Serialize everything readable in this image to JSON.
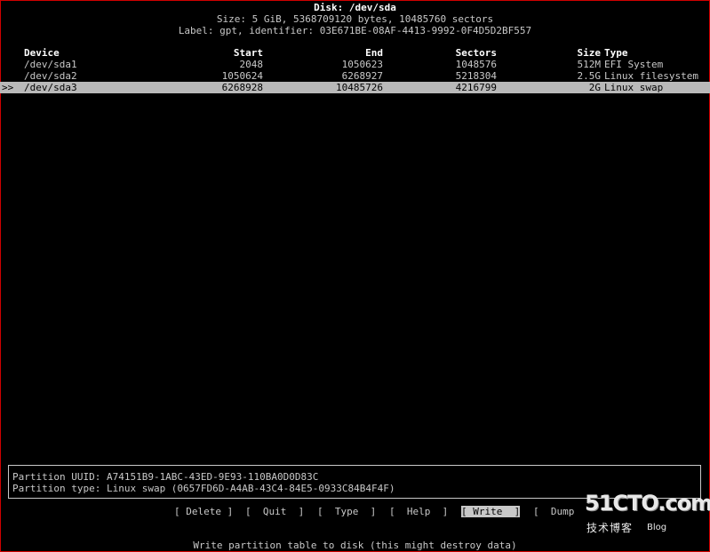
{
  "header": {
    "disk": "Disk: /dev/sda",
    "size": "Size: 5 GiB, 5368709120 bytes, 10485760 sectors",
    "label": "Label: gpt, identifier: 03E671BE-08AF-4413-9992-0F4D5D2BF557"
  },
  "table": {
    "columns": {
      "device": "Device",
      "start": "Start",
      "end": "End",
      "sectors": "Sectors",
      "size": "Size",
      "type": "Type"
    },
    "rows": [
      {
        "marker": "",
        "device": "/dev/sda1",
        "start": "2048",
        "end": "1050623",
        "sectors": "1048576",
        "size": "512M",
        "type": "EFI System",
        "selected": false
      },
      {
        "marker": "",
        "device": "/dev/sda2",
        "start": "1050624",
        "end": "6268927",
        "sectors": "5218304",
        "size": "2.5G",
        "type": "Linux filesystem",
        "selected": false
      },
      {
        "marker": ">>",
        "device": "/dev/sda3",
        "start": "6268928",
        "end": "10485726",
        "sectors": "4216799",
        "size": "2G",
        "type": "Linux swap",
        "selected": true
      }
    ]
  },
  "info": {
    "uuid": "Partition UUID: A74151B9-1ABC-43ED-9E93-110BA0D0D83C",
    "type": "Partition type: Linux swap (0657FD6D-A4AB-43C4-84E5-0933C84B4F4F)"
  },
  "menu": {
    "delete": "[ Delete ]",
    "quit": "[  Quit  ]",
    "type": "[  Type  ]",
    "help": "[  Help  ]",
    "write": "[ Write  ]",
    "dump": "[  Dump"
  },
  "hint": "Write partition table to disk (this might destroy data)",
  "watermark": {
    "brand": "51CTO.com",
    "sub": "技术博客",
    "url": "Blog"
  }
}
